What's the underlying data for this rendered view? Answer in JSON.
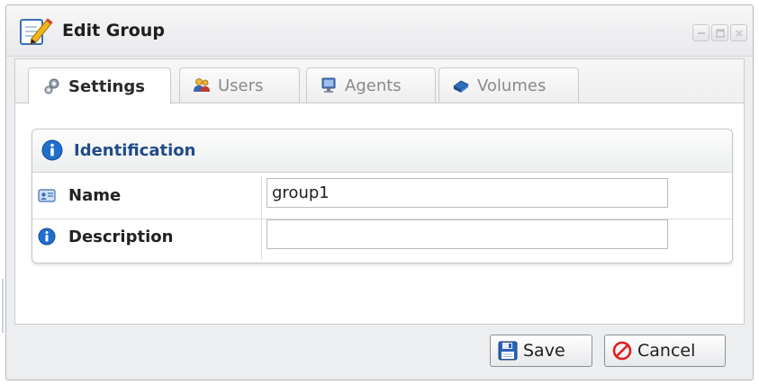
{
  "window": {
    "title": "Edit Group",
    "title_icon": "note-pencil-icon",
    "controls": [
      "minimize-icon",
      "restore-icon",
      "close-icon"
    ]
  },
  "tabs": [
    {
      "label": "Settings",
      "icon": "gears-icon",
      "active": true
    },
    {
      "label": "Users",
      "icon": "users-icon",
      "active": false
    },
    {
      "label": "Agents",
      "icon": "monitor-icon",
      "active": false
    },
    {
      "label": "Volumes",
      "icon": "volume-icon",
      "active": false
    }
  ],
  "panel": {
    "title": "Identification",
    "icon": "info-icon",
    "rows": [
      {
        "label": "Name",
        "icon": "id-card-icon",
        "value": "group1"
      },
      {
        "label": "Description",
        "icon": "info-icon",
        "value": ""
      }
    ]
  },
  "buttons": {
    "save": {
      "label": "Save",
      "icon": "floppy-disk-icon"
    },
    "cancel": {
      "label": "Cancel",
      "icon": "cancel-circle-icon"
    }
  },
  "colors": {
    "panel_title": "#1f4c8a",
    "info_blue": "#1f6fcf",
    "cancel_red": "#e01e1e"
  }
}
